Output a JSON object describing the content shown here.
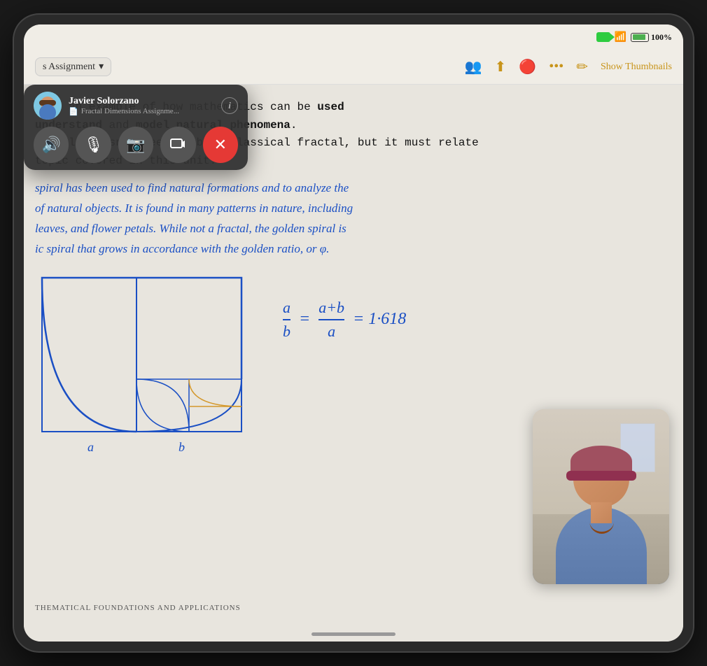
{
  "status_bar": {
    "battery_percent": "100%",
    "show_thumbnails": "Show Thumbnails"
  },
  "toolbar": {
    "assignment_label": "s Assignment",
    "chevron": "▾"
  },
  "facetime": {
    "user_name": "Javier Solorzano",
    "document_name": "Fractal Dimensions Assignme...",
    "doc_icon": "📄",
    "info_btn": "i",
    "controls": {
      "speaker": "🔊",
      "mic": "🎙",
      "camera": "📷",
      "screen_share": "⊡",
      "end_call": "✕"
    }
  },
  "content": {
    "typed_line1": "vide an example of how mathematics can be ",
    "typed_bold1": "used",
    "typed_line2": "understand",
    "typed_and": " and ",
    "typed_bold2": "model natural phenomena",
    "typed_period": ".",
    "typed_line3": "example doesn't need to be a classical fractal, but it must relate",
    "typed_line4": "topic covered in this unit.",
    "handwritten_line1": "spiral has been used to find natural formations  and to analyze the",
    "handwritten_line2": "of natural  objects. It is found in many patterns in nature, including",
    "handwritten_line3": "leaves, and flower petals. While not a fractal, the golden spiral is",
    "handwritten_line4": "ic spiral that grows in accordance with the golden ratio, or φ.",
    "formula": "a/b = (a+b)/a = 1.618",
    "diagram_label_a": "a",
    "diagram_label_b": "b",
    "bottom_label": "THEMATICAL FOUNDATIONS AND APPLICATIONS"
  }
}
